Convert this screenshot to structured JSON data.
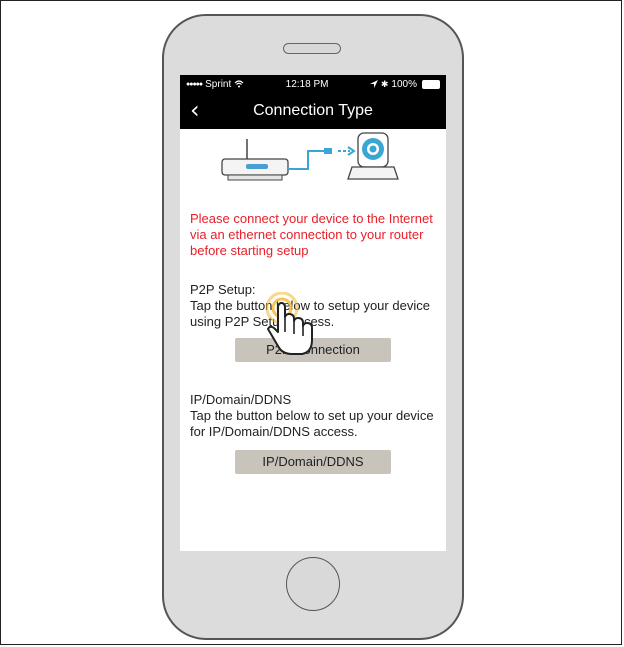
{
  "status_bar": {
    "carrier": "Sprint",
    "time": "12:18 PM",
    "battery": "100%"
  },
  "nav": {
    "back_glyph": "‹",
    "title": "Connection Type"
  },
  "warning_text": "Please connect your device to the Internet via an ethernet connection to your router before starting setup",
  "p2p": {
    "heading": "P2P Setup:",
    "description": "Tap the button below to setup your device using P2P Setup access.",
    "button_label": "P2P Connection"
  },
  "ip": {
    "heading": "IP/Domain/DDNS",
    "description": "Tap the button below to set up your device for IP/Domain/DDNS access.",
    "button_label": "IP/Domain/DDNS"
  },
  "colors": {
    "warning": "#e8202a",
    "accent_cable": "#3aa6d6",
    "tap_ring": "#f2b830",
    "button_bg": "#c8c4bc"
  },
  "icons": [
    "wifi-icon",
    "location-arrow-icon",
    "bluetooth-icon",
    "battery-icon",
    "back-chevron-icon",
    "router-icon",
    "ethernet-cable-icon",
    "ip-camera-icon",
    "tap-hand-icon"
  ]
}
